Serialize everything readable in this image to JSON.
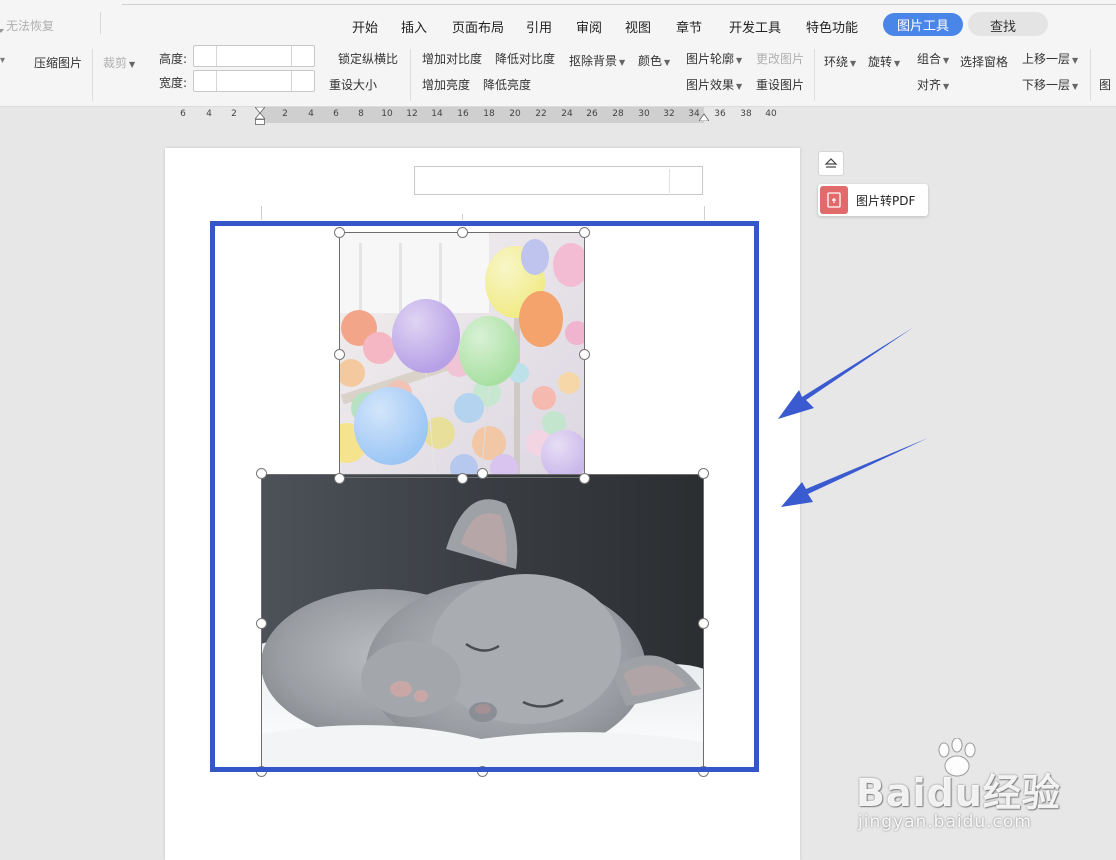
{
  "menu": {
    "undo_label": "无法恢复",
    "tabs": [
      "开始",
      "插入",
      "页面布局",
      "引用",
      "审阅",
      "视图",
      "章节",
      "开发工具",
      "特色功能"
    ],
    "active_tab": "图片工具",
    "search_label": "查找"
  },
  "ribbon": {
    "compress": "压缩图片",
    "crop": "裁剪",
    "height_label": "高度:",
    "width_label": "宽度:",
    "height_value": "",
    "width_value": "",
    "lock_ratio": "锁定纵横比",
    "reset_size": "重设大小",
    "increase_contrast": "增加对比度",
    "decrease_contrast": "降低对比度",
    "remove_bg": "抠除背景",
    "color": "颜色",
    "increase_brightness": "增加亮度",
    "decrease_brightness": "降低亮度",
    "outline": "图片轮廓",
    "change_picture": "更改图片",
    "effects": "图片效果",
    "reset_picture": "重设图片",
    "wrap": "环绕",
    "rotate": "旋转",
    "group": "组合",
    "align": "对齐",
    "selection_pane": "选择窗格",
    "bring_forward": "上移一层",
    "send_backward": "下移一层",
    "cut_off": "图"
  },
  "ruler": {
    "labels": [
      "6",
      "4",
      "2",
      "2",
      "4",
      "6",
      "8",
      "10",
      "12",
      "14",
      "16",
      "18",
      "20",
      "22",
      "24",
      "26",
      "28",
      "30",
      "32",
      "34",
      "36",
      "38",
      "40"
    ]
  },
  "side_panel": {
    "pdf_label": "图片转PDF"
  },
  "document": {
    "images": [
      {
        "name": "balloons-image",
        "subject": "pastel balloons"
      },
      {
        "name": "kitten-image",
        "subject": "sleeping grey kitten"
      }
    ]
  },
  "watermark": {
    "logo": "Baidu经验",
    "url": "jingyan.baidu.com"
  },
  "colors": {
    "accent": "#4a86e8",
    "highlight_frame": "#3456c8",
    "arrow": "#3a5bd0",
    "pdf_icon": "#e26a6a"
  }
}
